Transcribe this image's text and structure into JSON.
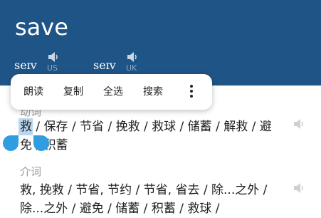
{
  "headword": "save",
  "pronunciations": [
    {
      "ipa": "seɪv",
      "region": "US",
      "icon": "speaker-icon"
    },
    {
      "ipa": "seɪv",
      "region": "UK",
      "icon": "speaker-icon"
    }
  ],
  "context_menu": {
    "items": [
      "朗读",
      "复制",
      "全选",
      "搜索"
    ],
    "more_icon": "more-vert-icon"
  },
  "sections": [
    {
      "label": "动词",
      "meaning_first": "救",
      "meaning_rest": " / 保存 / 节省 / 挽救 / 救球 / 储蓄 / 解救 / 避免 / 积蓄"
    },
    {
      "label": "介词",
      "meaning_first": "",
      "meaning_rest": "救, 挽救 / 节省, 节约 / 节省, 省去 / 除...之外 / 除...之外 / 避免 / 储蓄 / 积蓄 / 救球 /"
    }
  ],
  "colors": {
    "header_bg": "#1f5486",
    "selection": "#b9d7f0",
    "handle": "#2f9de0"
  }
}
